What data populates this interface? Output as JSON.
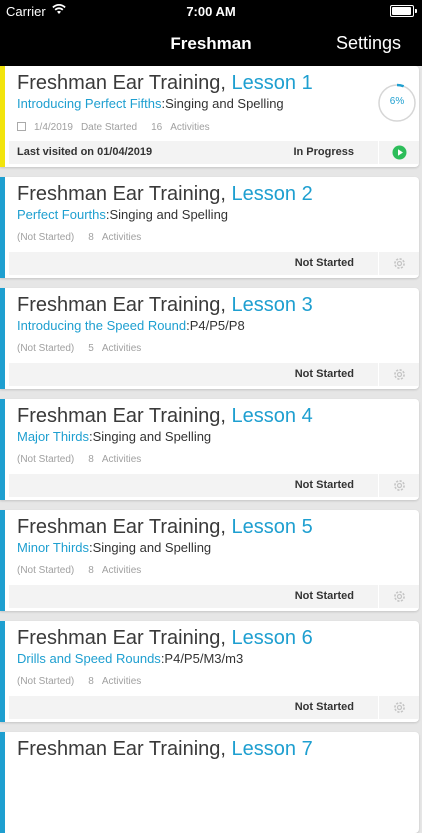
{
  "status_bar": {
    "carrier": "Carrier",
    "time": "7:00 AM"
  },
  "nav": {
    "title": "Freshman",
    "settings_label": "Settings"
  },
  "colors": {
    "accent_active": "#f2e40c",
    "accent": "#1e9fd0",
    "link": "#1e9fd0",
    "play": "#2dbd5a"
  },
  "lessons": [
    {
      "course": "Freshman Ear Training, ",
      "lesson": "Lesson 1",
      "topic": "Introducing Perfect Fifths",
      "topic_rest": ":Singing and Spelling",
      "date": "1/4/2019",
      "date_label": "Date Started",
      "activities_count": "16",
      "activities_label": "Activities",
      "last_visited": "Last visited on 01/04/2019",
      "status": "In Progress",
      "progress_label": "6%",
      "progress": 0.06,
      "action_icon": "play-icon"
    },
    {
      "course": "Freshman Ear Training, ",
      "lesson": "Lesson 2",
      "topic": "Perfect Fourths",
      "topic_rest": ":Singing and Spelling",
      "not_started": "(Not Started)",
      "activities_count": "8",
      "activities_label": "Activities",
      "status": "Not Started",
      "action_icon": "gear-icon"
    },
    {
      "course": "Freshman Ear Training, ",
      "lesson": "Lesson 3",
      "topic": "Introducing the Speed Round",
      "topic_rest": ":P4/P5/P8",
      "not_started": "(Not Started)",
      "activities_count": "5",
      "activities_label": "Activities",
      "status": "Not Started",
      "action_icon": "gear-icon"
    },
    {
      "course": "Freshman Ear Training, ",
      "lesson": "Lesson 4",
      "topic": "Major Thirds",
      "topic_rest": ":Singing and Spelling",
      "not_started": "(Not Started)",
      "activities_count": "8",
      "activities_label": "Activities",
      "status": "Not Started",
      "action_icon": "gear-icon"
    },
    {
      "course": "Freshman Ear Training, ",
      "lesson": "Lesson 5",
      "topic": "Minor Thirds",
      "topic_rest": ":Singing and Spelling",
      "not_started": "(Not Started)",
      "activities_count": "8",
      "activities_label": "Activities",
      "status": "Not Started",
      "action_icon": "gear-icon"
    },
    {
      "course": "Freshman Ear Training, ",
      "lesson": "Lesson 6",
      "topic": "Drills and Speed Rounds",
      "topic_rest": ":P4/P5/M3/m3",
      "not_started": "(Not Started)",
      "activities_count": "8",
      "activities_label": "Activities",
      "status": "Not Started",
      "action_icon": "gear-icon"
    },
    {
      "course": "Freshman Ear Training, ",
      "lesson": "Lesson 7"
    }
  ]
}
